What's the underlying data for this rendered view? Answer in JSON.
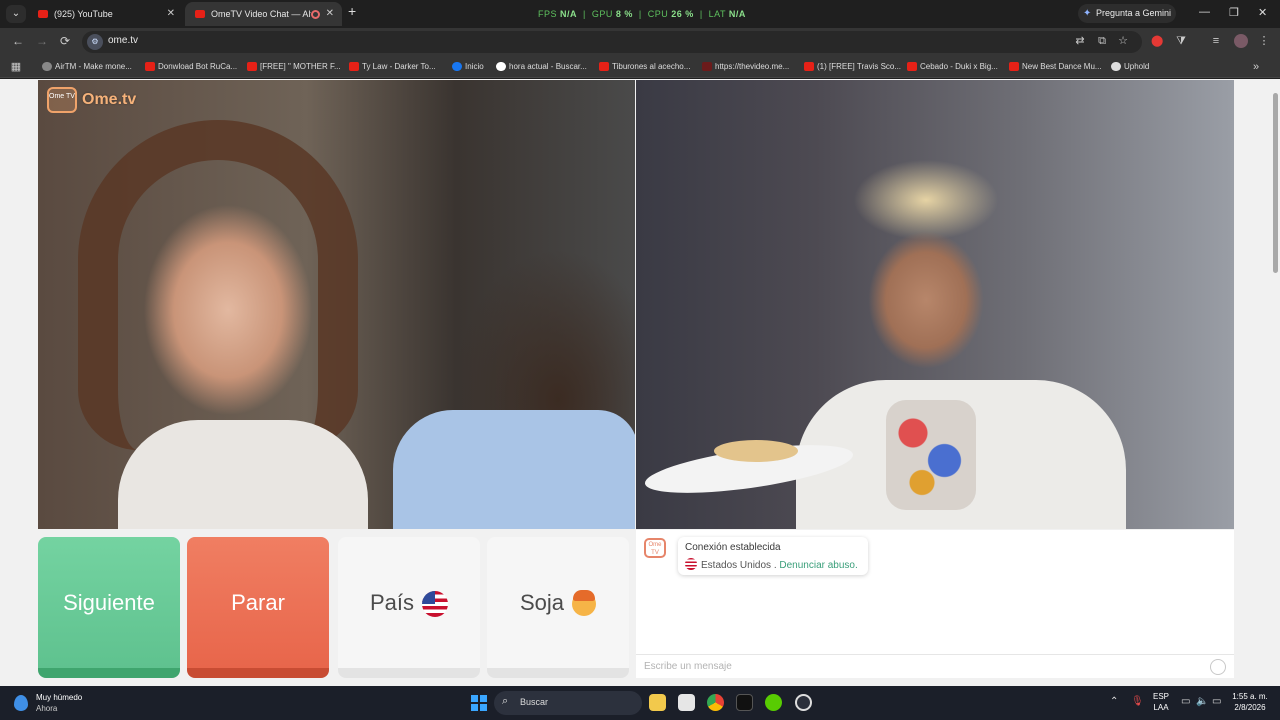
{
  "browser": {
    "tabs": [
      {
        "title": "(925) YouTube",
        "close": "✕"
      },
      {
        "title": "OmeTV Video Chat — Alter",
        "close": "✕"
      }
    ],
    "new_tab": "+",
    "perf": {
      "fps_label": "FPS",
      "fps": "N/A",
      "gpu_label": "GPU",
      "gpu": "8 %",
      "cpu_label": "CPU",
      "cpu": "26 %",
      "lat_label": "LAT",
      "lat": "N/A"
    },
    "gemini": "Pregunta a Gemini",
    "window": {
      "minimize": "—",
      "restore": "❐",
      "close": "✕"
    },
    "nav": {
      "back": "←",
      "forward": "→",
      "reload": "⟳"
    },
    "url": "ome.tv",
    "bookmarks": [
      "AirTM - Make mone...",
      "Donwload Bot RuCa...",
      "[FREE] \" MOTHER F...",
      "Ty Law - Darker To...",
      "Inicio",
      "hora actual - Buscar...",
      "Tiburones al acecho...",
      "https://thevideo.me...",
      "(1) [FREE] Travis Sco...",
      "Cebado - Duki x Big...",
      "New Best Dance Mu...",
      "Uphold"
    ],
    "more_bookmarks": "»"
  },
  "ometv": {
    "logo_icon": "Ome TV",
    "logo_text": "Ome.tv",
    "buttons": {
      "next": "Siguiente",
      "stop": "Parar",
      "country": "País",
      "gender": "Soja"
    },
    "chat": {
      "avatar": "Ome TV",
      "status": "Conexión establecida",
      "country": "Estados Unidos .",
      "report_link": "Denunciar abuso.",
      "placeholder": "Escribe un mensaje"
    }
  },
  "taskbar": {
    "weather_title": "Muy húmedo",
    "weather_sub": "Ahora",
    "search_label": "Buscar",
    "lang_1": "ESP",
    "lang_2": "LAA",
    "time": "1:55 a. m.",
    "date": "2/8/2026"
  },
  "colors": {
    "next_green": "#5fc28f",
    "stop_red": "#e8664b",
    "brand_orange": "#f0a36a",
    "link_green": "#3a9f7a"
  }
}
